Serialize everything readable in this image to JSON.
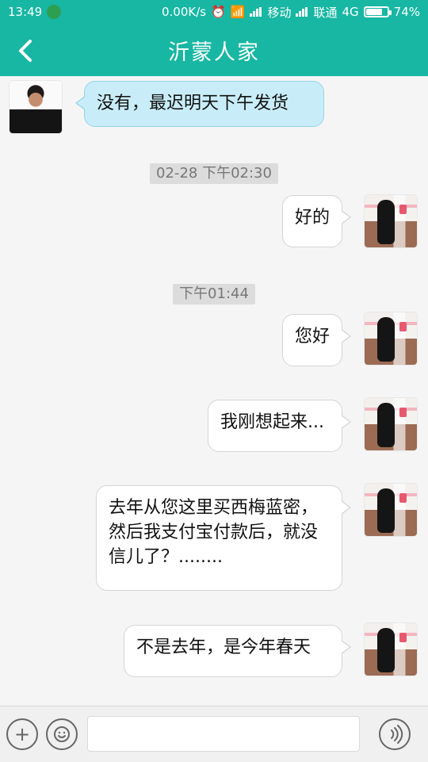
{
  "status": {
    "time": "13:49",
    "speed": "0.00K/s",
    "carrier1": "移动",
    "carrier2": "联通",
    "network": "4G",
    "battery": "74%",
    "battery_level": 0.74
  },
  "header": {
    "title": "沂蒙人家"
  },
  "messages": [
    {
      "side": "left",
      "text": "没有，最迟明天下午发货"
    },
    {
      "side": "time",
      "text": "02-28 下午02:30"
    },
    {
      "side": "right",
      "text": "好的"
    },
    {
      "side": "time",
      "text": "下午01:44"
    },
    {
      "side": "right",
      "text": "您好"
    },
    {
      "side": "right",
      "text": "我刚想起来..."
    },
    {
      "side": "right",
      "text": "去年从您这里买西梅蓝密，然后我支付宝付款后，就没信儿了？........"
    },
    {
      "side": "right",
      "text": "不是去年，是今年春天"
    }
  ],
  "footer": {
    "plus_icon": "plus-icon",
    "emoji_icon": "emoji-icon",
    "voice_icon": "voice-icon"
  }
}
